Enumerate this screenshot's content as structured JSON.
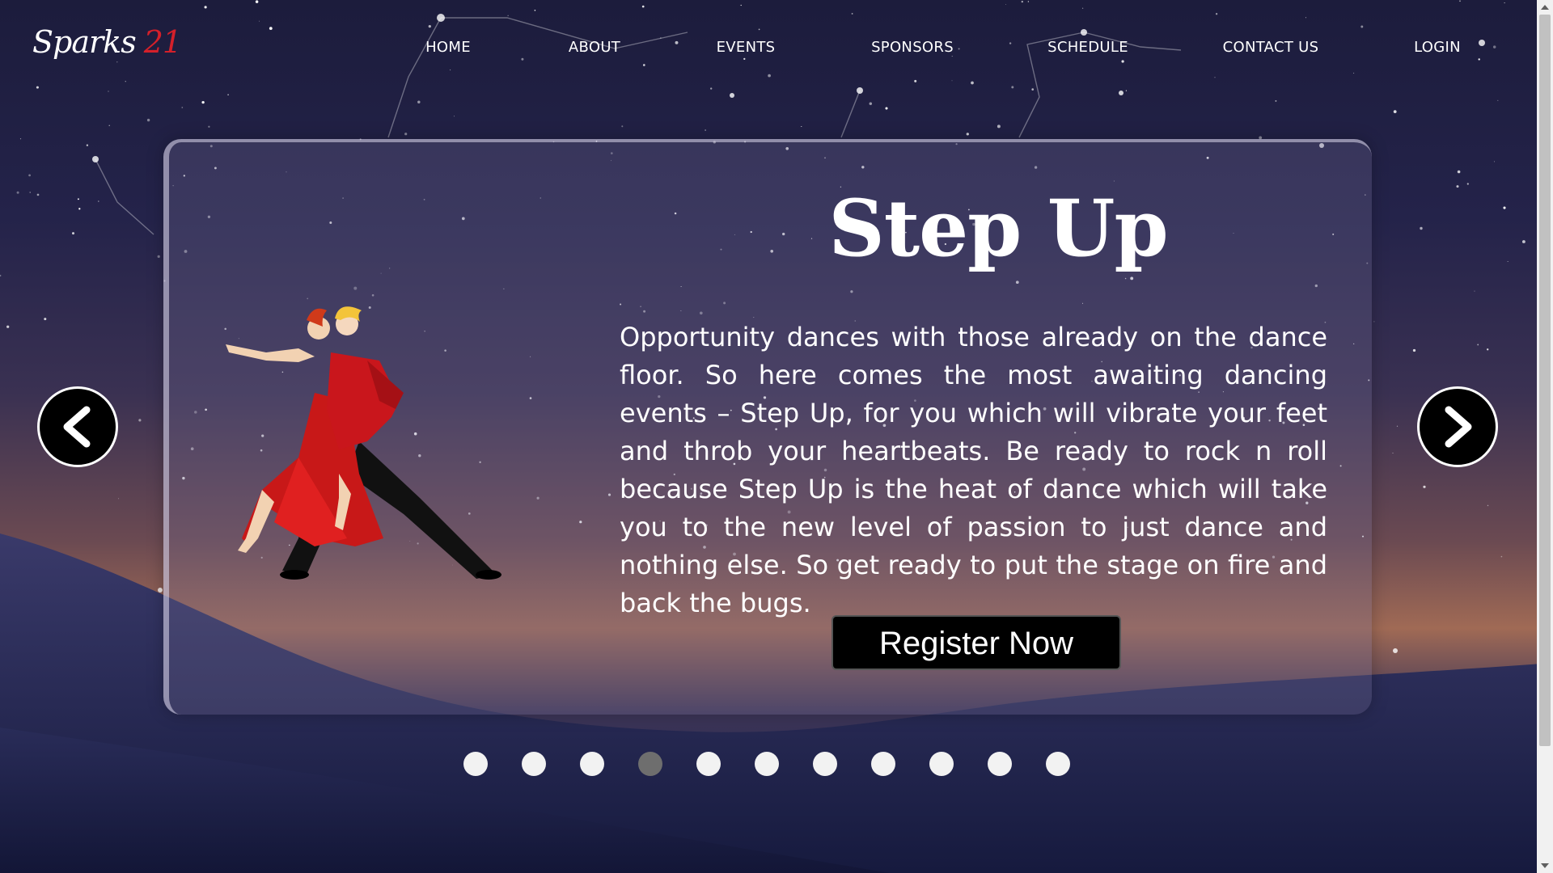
{
  "brand": {
    "name": "Sparks",
    "suffix": "21"
  },
  "nav": {
    "items": [
      "HOME",
      "ABOUT",
      "EVENTS",
      "SPONSORS",
      "SCHEDULE",
      "CONTACT US",
      "LOGIN"
    ]
  },
  "slide": {
    "title": "Step Up",
    "description": "Opportunity dances with those already on the dance floor. So here comes the most awaiting dancing events – Step Up, for you which will vibrate your feet and throb your heartbeats. Be ready to rock n roll because Step Up is the heat of dance which will take you to the new level of passion to just dance and nothing else. So get ready to put the stage on fire and back the bugs.",
    "register_label": "Register Now",
    "image": "dancing-couple-illustration"
  },
  "carousel": {
    "prev_icon": "chevron-left-icon",
    "next_icon": "chevron-right-icon",
    "slide_count": 11,
    "active_index": 3
  },
  "colors": {
    "accent_red": "#d4202a",
    "button_bg": "#000000",
    "dot": "#f2f2f2",
    "dot_active": "#6e6e6e"
  }
}
